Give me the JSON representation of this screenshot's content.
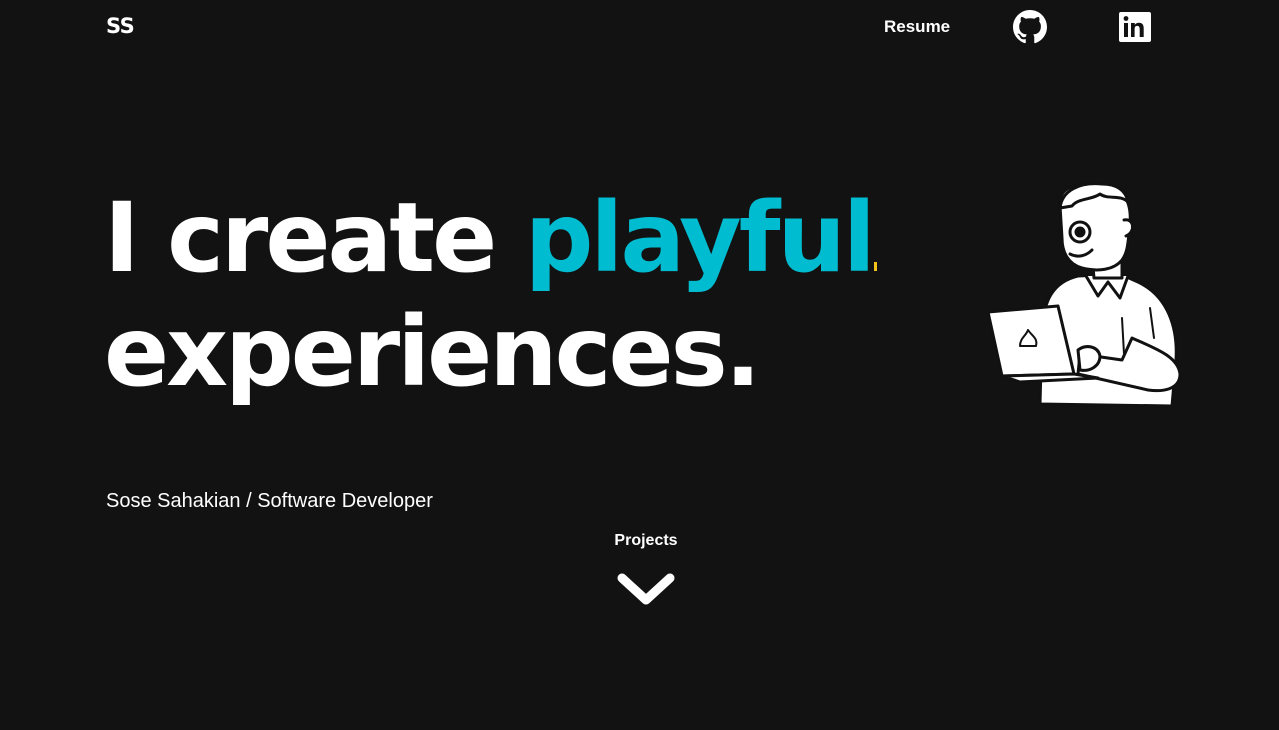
{
  "header": {
    "logo": "SS",
    "nav": {
      "resume_label": "Resume",
      "github_icon": "github-icon",
      "linkedin_icon": "linkedin-icon"
    }
  },
  "hero": {
    "line1_prefix": "I create ",
    "line1_highlight": "playful",
    "line2": "experiences.",
    "subtitle": "Sose Sahakian / Software Developer"
  },
  "projects": {
    "label": "Projects",
    "icon": "chevron-down-icon"
  },
  "illustration": {
    "icon": "developer-with-laptop-illustration"
  },
  "colors": {
    "background": "#121212",
    "text": "#ffffff",
    "accent": "#00bcd0",
    "cursor": "#f2c21b"
  }
}
